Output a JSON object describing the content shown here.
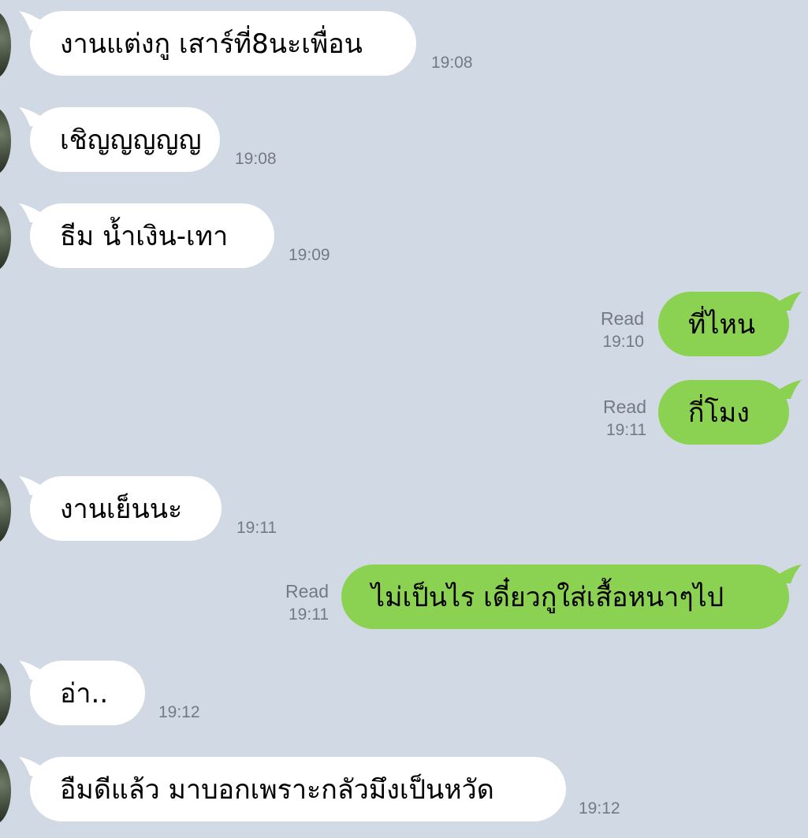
{
  "chat": {
    "messages": [
      {
        "side": "in",
        "text": "งานแต่งกู เสาร์ที่8นะเพื่อน",
        "time": "19:08"
      },
      {
        "side": "in",
        "text": "เชิญญญญญ",
        "time": "19:08"
      },
      {
        "side": "in",
        "text": "ธีม น้ำเงิน-เทา",
        "time": "19:09"
      },
      {
        "side": "out",
        "text": "ที่ไหน",
        "status": "Read",
        "time": "19:10"
      },
      {
        "side": "out",
        "text": "กี่โมง",
        "status": "Read",
        "time": "19:11"
      },
      {
        "side": "in",
        "text": "งานเย็นนะ",
        "time": "19:11"
      },
      {
        "side": "out",
        "text": "ไม่เป็นไร เดี๋ยวกูใส่เสื้อหนาๆไป",
        "status": "Read",
        "time": "19:11"
      },
      {
        "side": "in",
        "text": "อ่า..",
        "time": "19:12"
      },
      {
        "side": "in",
        "text": "อืมดีแล้ว มาบอกเพราะกลัวมึงเป็นหวัด",
        "time": "19:12"
      }
    ]
  },
  "colors": {
    "background": "#d0d9e4",
    "incoming_bubble": "#ffffff",
    "outgoing_bubble": "#8bd152",
    "meta_text": "#737a84"
  }
}
